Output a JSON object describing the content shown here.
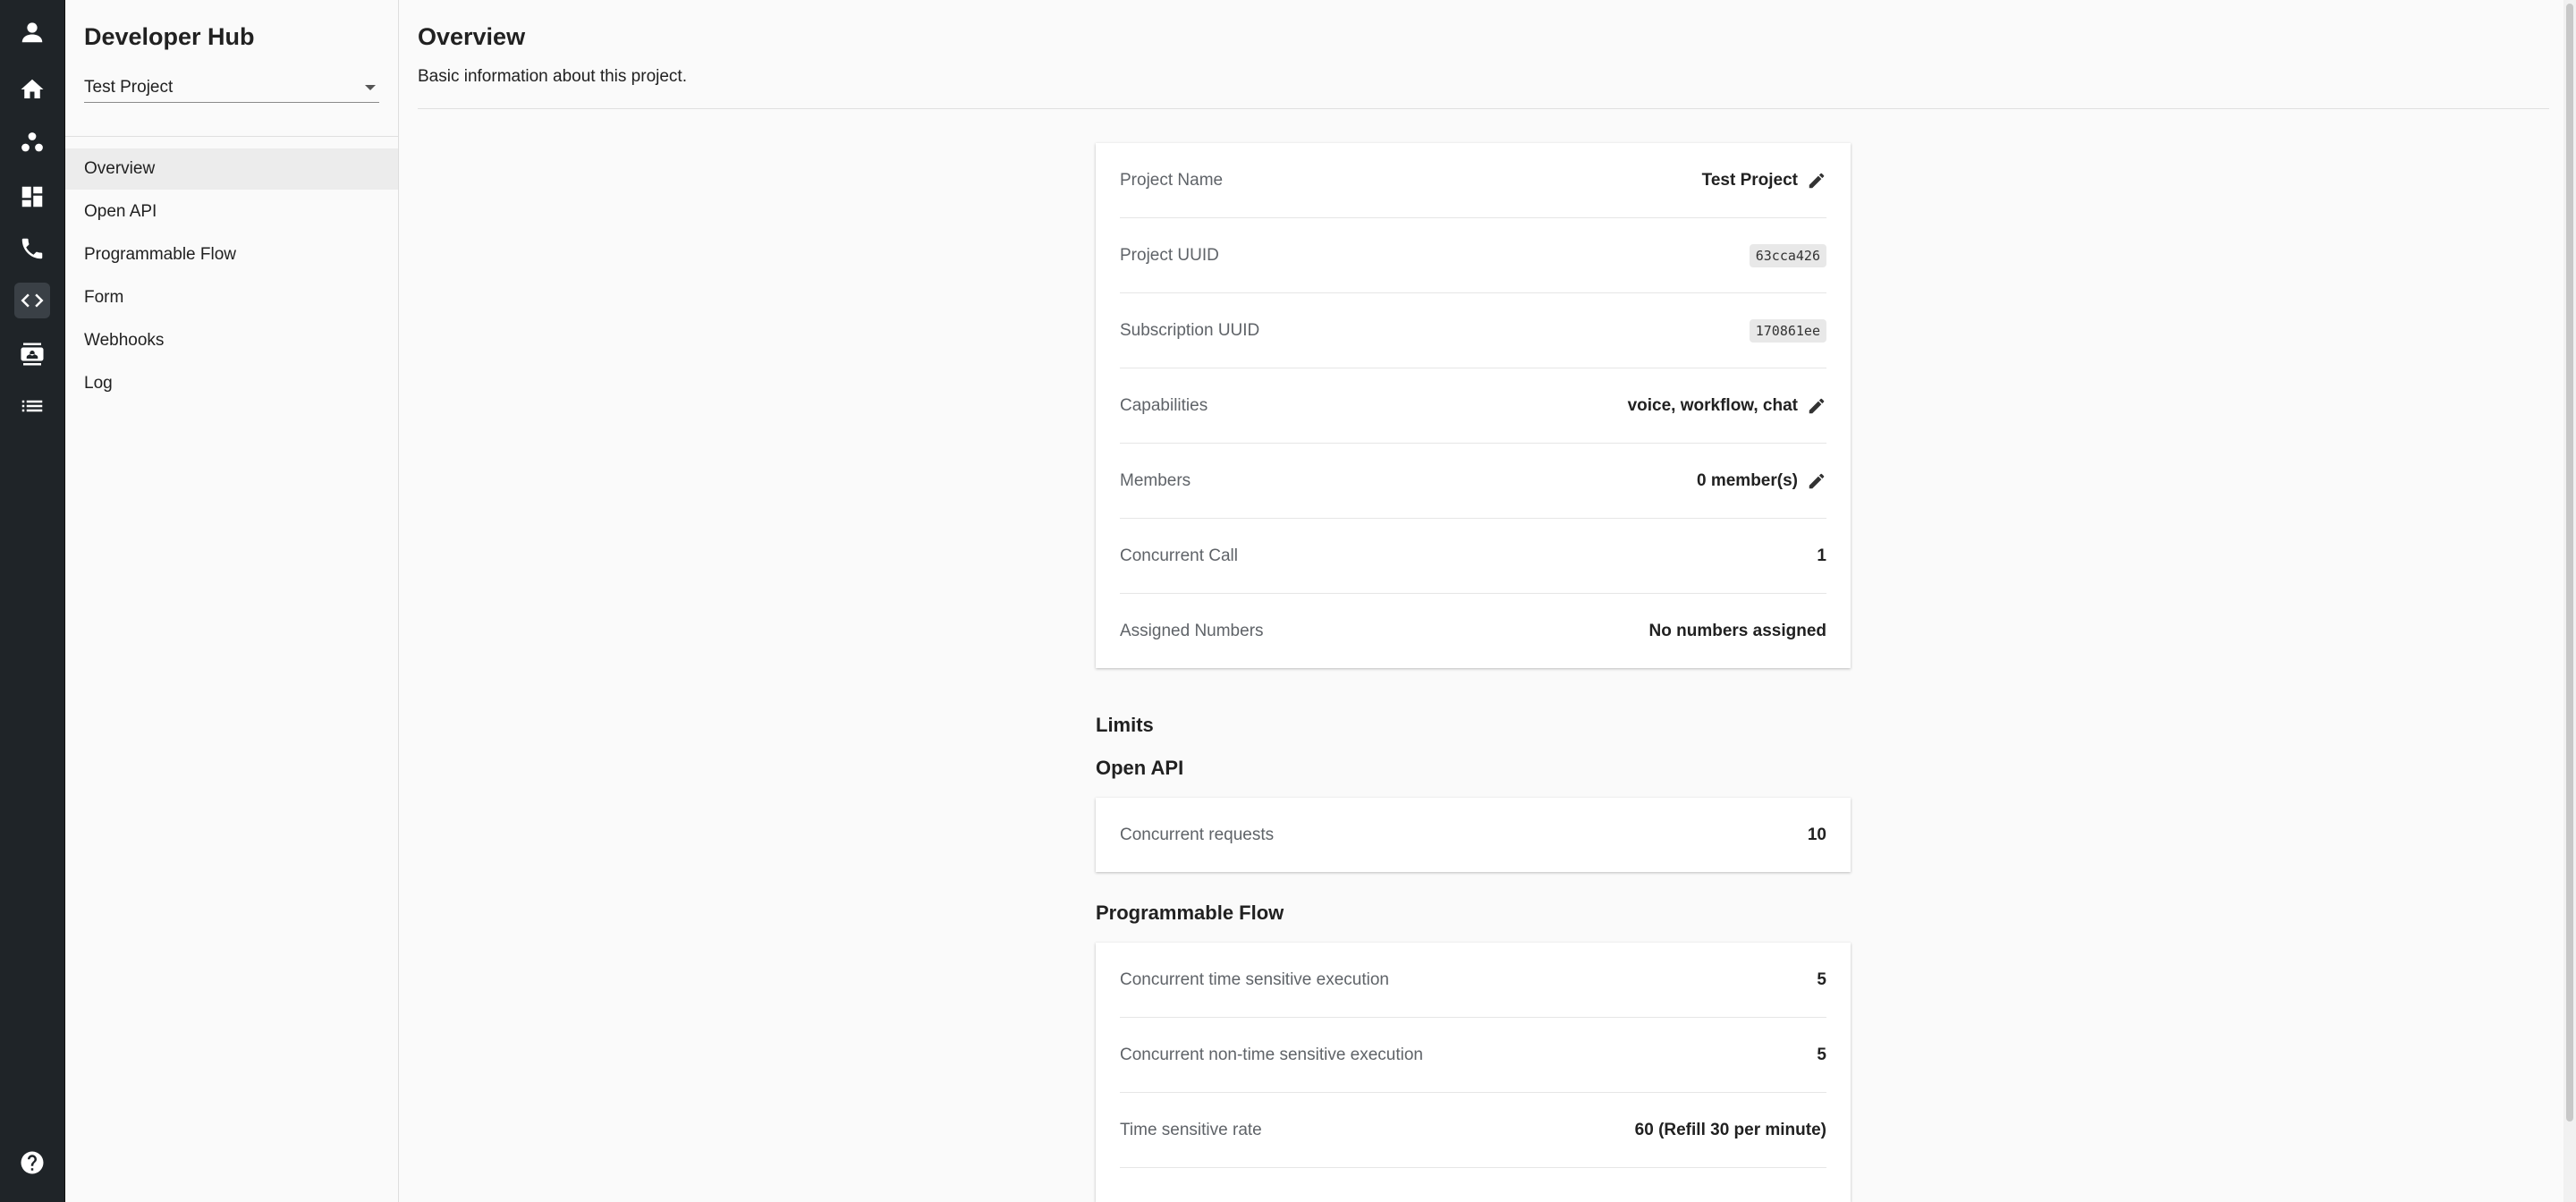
{
  "rail": {
    "icons": [
      "user-icon",
      "home-icon",
      "people-icon",
      "dashboard-icon",
      "phone-icon",
      "code-icon",
      "contacts-icon",
      "list-icon"
    ],
    "help_icon": "help-icon"
  },
  "nav": {
    "title": "Developer Hub",
    "project_select": "Test Project",
    "items": [
      {
        "label": "Overview",
        "active": true
      },
      {
        "label": "Open API"
      },
      {
        "label": "Programmable Flow"
      },
      {
        "label": "Form"
      },
      {
        "label": "Webhooks"
      },
      {
        "label": "Log"
      }
    ]
  },
  "main": {
    "title": "Overview",
    "subtitle": "Basic information about this project.",
    "project_info": [
      {
        "label": "Project Name",
        "value": "Test Project"
      },
      {
        "label": "Project UUID",
        "value": "63cca426"
      },
      {
        "label": "Subscription UUID",
        "value": "170861ee"
      },
      {
        "label": "Capabilities",
        "value": "voice, workflow, chat"
      },
      {
        "label": "Members",
        "value": "0 member(s)"
      },
      {
        "label": "Concurrent Call",
        "value": "1"
      },
      {
        "label": "Assigned Numbers",
        "value": "No numbers assigned"
      }
    ],
    "limits_heading": "Limits",
    "open_api_heading": "Open API",
    "open_api": [
      {
        "label": "Concurrent requests",
        "value": "10"
      }
    ],
    "flow_heading": "Programmable Flow",
    "flow": [
      {
        "label": "Concurrent time sensitive execution",
        "value": "5"
      },
      {
        "label": "Concurrent non-time sensitive execution",
        "value": "5"
      },
      {
        "label": "Time sensitive rate",
        "value": "60 (Refill 30 per minute)"
      }
    ]
  }
}
